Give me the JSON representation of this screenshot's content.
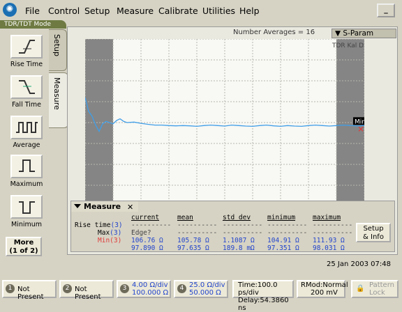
{
  "menu": {
    "items": [
      "File",
      "Control",
      "Setup",
      "Measure",
      "Calibrate",
      "Utilities",
      "Help"
    ],
    "minimize_label": "_"
  },
  "mode_tab": "TDR/TDT Mode",
  "left_panel": {
    "tools": [
      {
        "label": "Rise Time",
        "icon": "rise-time-icon"
      },
      {
        "label": "Fall Time",
        "icon": "fall-time-icon"
      },
      {
        "label": "Average",
        "icon": "average-icon"
      },
      {
        "label": "Maximum",
        "icon": "maximum-icon"
      },
      {
        "label": "Minimum",
        "icon": "minimum-icon"
      }
    ],
    "more_line1": "More",
    "more_line2": "(1 of 2)"
  },
  "vtabs": {
    "setup": "Setup",
    "measure": "Measure"
  },
  "scope": {
    "averages": "Number Averages =   16",
    "sparam_label": "S-Param",
    "tdr_labels": "TDR Kal  Dif",
    "marker_label": "Min",
    "colors": {
      "trace": "#3f9ee8",
      "grid": "#b8b8b0",
      "shade": "#858585"
    },
    "trace_points": [
      [
        0,
        1.0
      ],
      [
        0.5,
        0.45
      ],
      [
        1,
        0.25
      ],
      [
        1.5,
        -0.1
      ],
      [
        2,
        -0.35
      ],
      [
        2.5,
        -0.05
      ],
      [
        3,
        0.05
      ],
      [
        3.5,
        0.0
      ],
      [
        4,
        -0.05
      ],
      [
        4.5,
        0.08
      ],
      [
        5,
        0.15
      ],
      [
        5.5,
        0.05
      ],
      [
        6,
        0.0
      ],
      [
        7,
        0.02
      ],
      [
        8,
        -0.03
      ],
      [
        9,
        -0.07
      ],
      [
        10,
        -0.1
      ],
      [
        11,
        -0.1
      ],
      [
        12,
        -0.12
      ],
      [
        13,
        -0.13
      ],
      [
        14,
        -0.12
      ],
      [
        15,
        -0.13
      ],
      [
        16,
        -0.15
      ],
      [
        17,
        -0.12
      ],
      [
        18,
        -0.1
      ],
      [
        19,
        -0.12
      ],
      [
        20,
        -0.14
      ],
      [
        21,
        -0.1
      ],
      [
        22,
        -0.12
      ],
      [
        23,
        -0.14
      ],
      [
        24,
        -0.15
      ],
      [
        25,
        -0.12
      ],
      [
        26,
        -0.1
      ],
      [
        27,
        -0.13
      ],
      [
        28,
        -0.15
      ],
      [
        29,
        -0.12
      ],
      [
        30,
        -0.14
      ],
      [
        31,
        -0.15
      ],
      [
        32,
        -0.12
      ],
      [
        33,
        -0.1
      ],
      [
        34,
        -0.12
      ],
      [
        35,
        -0.14
      ],
      [
        36,
        -0.12
      ],
      [
        37,
        -0.1
      ],
      [
        38,
        -0.12
      ],
      [
        39,
        -0.13
      ],
      [
        40,
        -0.12
      ]
    ]
  },
  "measure_panel": {
    "title": "Measure",
    "close": "✕",
    "row_labels": [
      {
        "name": "Rise time",
        "ch": "(3)"
      },
      {
        "name": "Max",
        "ch": "(3)"
      },
      {
        "name": "Min",
        "ch": "(3)"
      }
    ],
    "columns": [
      {
        "header": "current",
        "values": [
          "Edge?",
          "106.76 Ω",
          "97.890 Ω"
        ]
      },
      {
        "header": "mean",
        "values": [
          "----------",
          "105.78 Ω",
          "97.635 Ω"
        ]
      },
      {
        "header": "std dev",
        "values": [
          "----------",
          "1.1087 Ω",
          "189.8 mΩ"
        ]
      },
      {
        "header": "minimum",
        "values": [
          "----------",
          "104.91 Ω",
          "97.351 Ω"
        ]
      },
      {
        "header": "maximum",
        "values": [
          "----------",
          "111.93 Ω",
          "98.031 Ω"
        ]
      }
    ],
    "setup_line1": "Setup",
    "setup_line2": "& Info"
  },
  "datetime": "25 Jan 2003   07:48",
  "bottom": {
    "ch1": {
      "num": "1",
      "label": "Not Present"
    },
    "ch2": {
      "num": "2",
      "label": "Not Present"
    },
    "ch3": {
      "num": "3",
      "line1": "4.00 Ω/div",
      "line2": "100.000 Ω"
    },
    "ch4": {
      "num": "4",
      "line1": "25.0 Ω/div",
      "line2": "50.000 Ω"
    },
    "time_line1": "Time:100.0 ps/div",
    "time_line2": "Delay:54.3860 ns",
    "rmod_line1": "RMod:Normal",
    "rmod_line2": "200 mV",
    "pattern_line1": "Pattern",
    "pattern_line2": "Lock"
  }
}
